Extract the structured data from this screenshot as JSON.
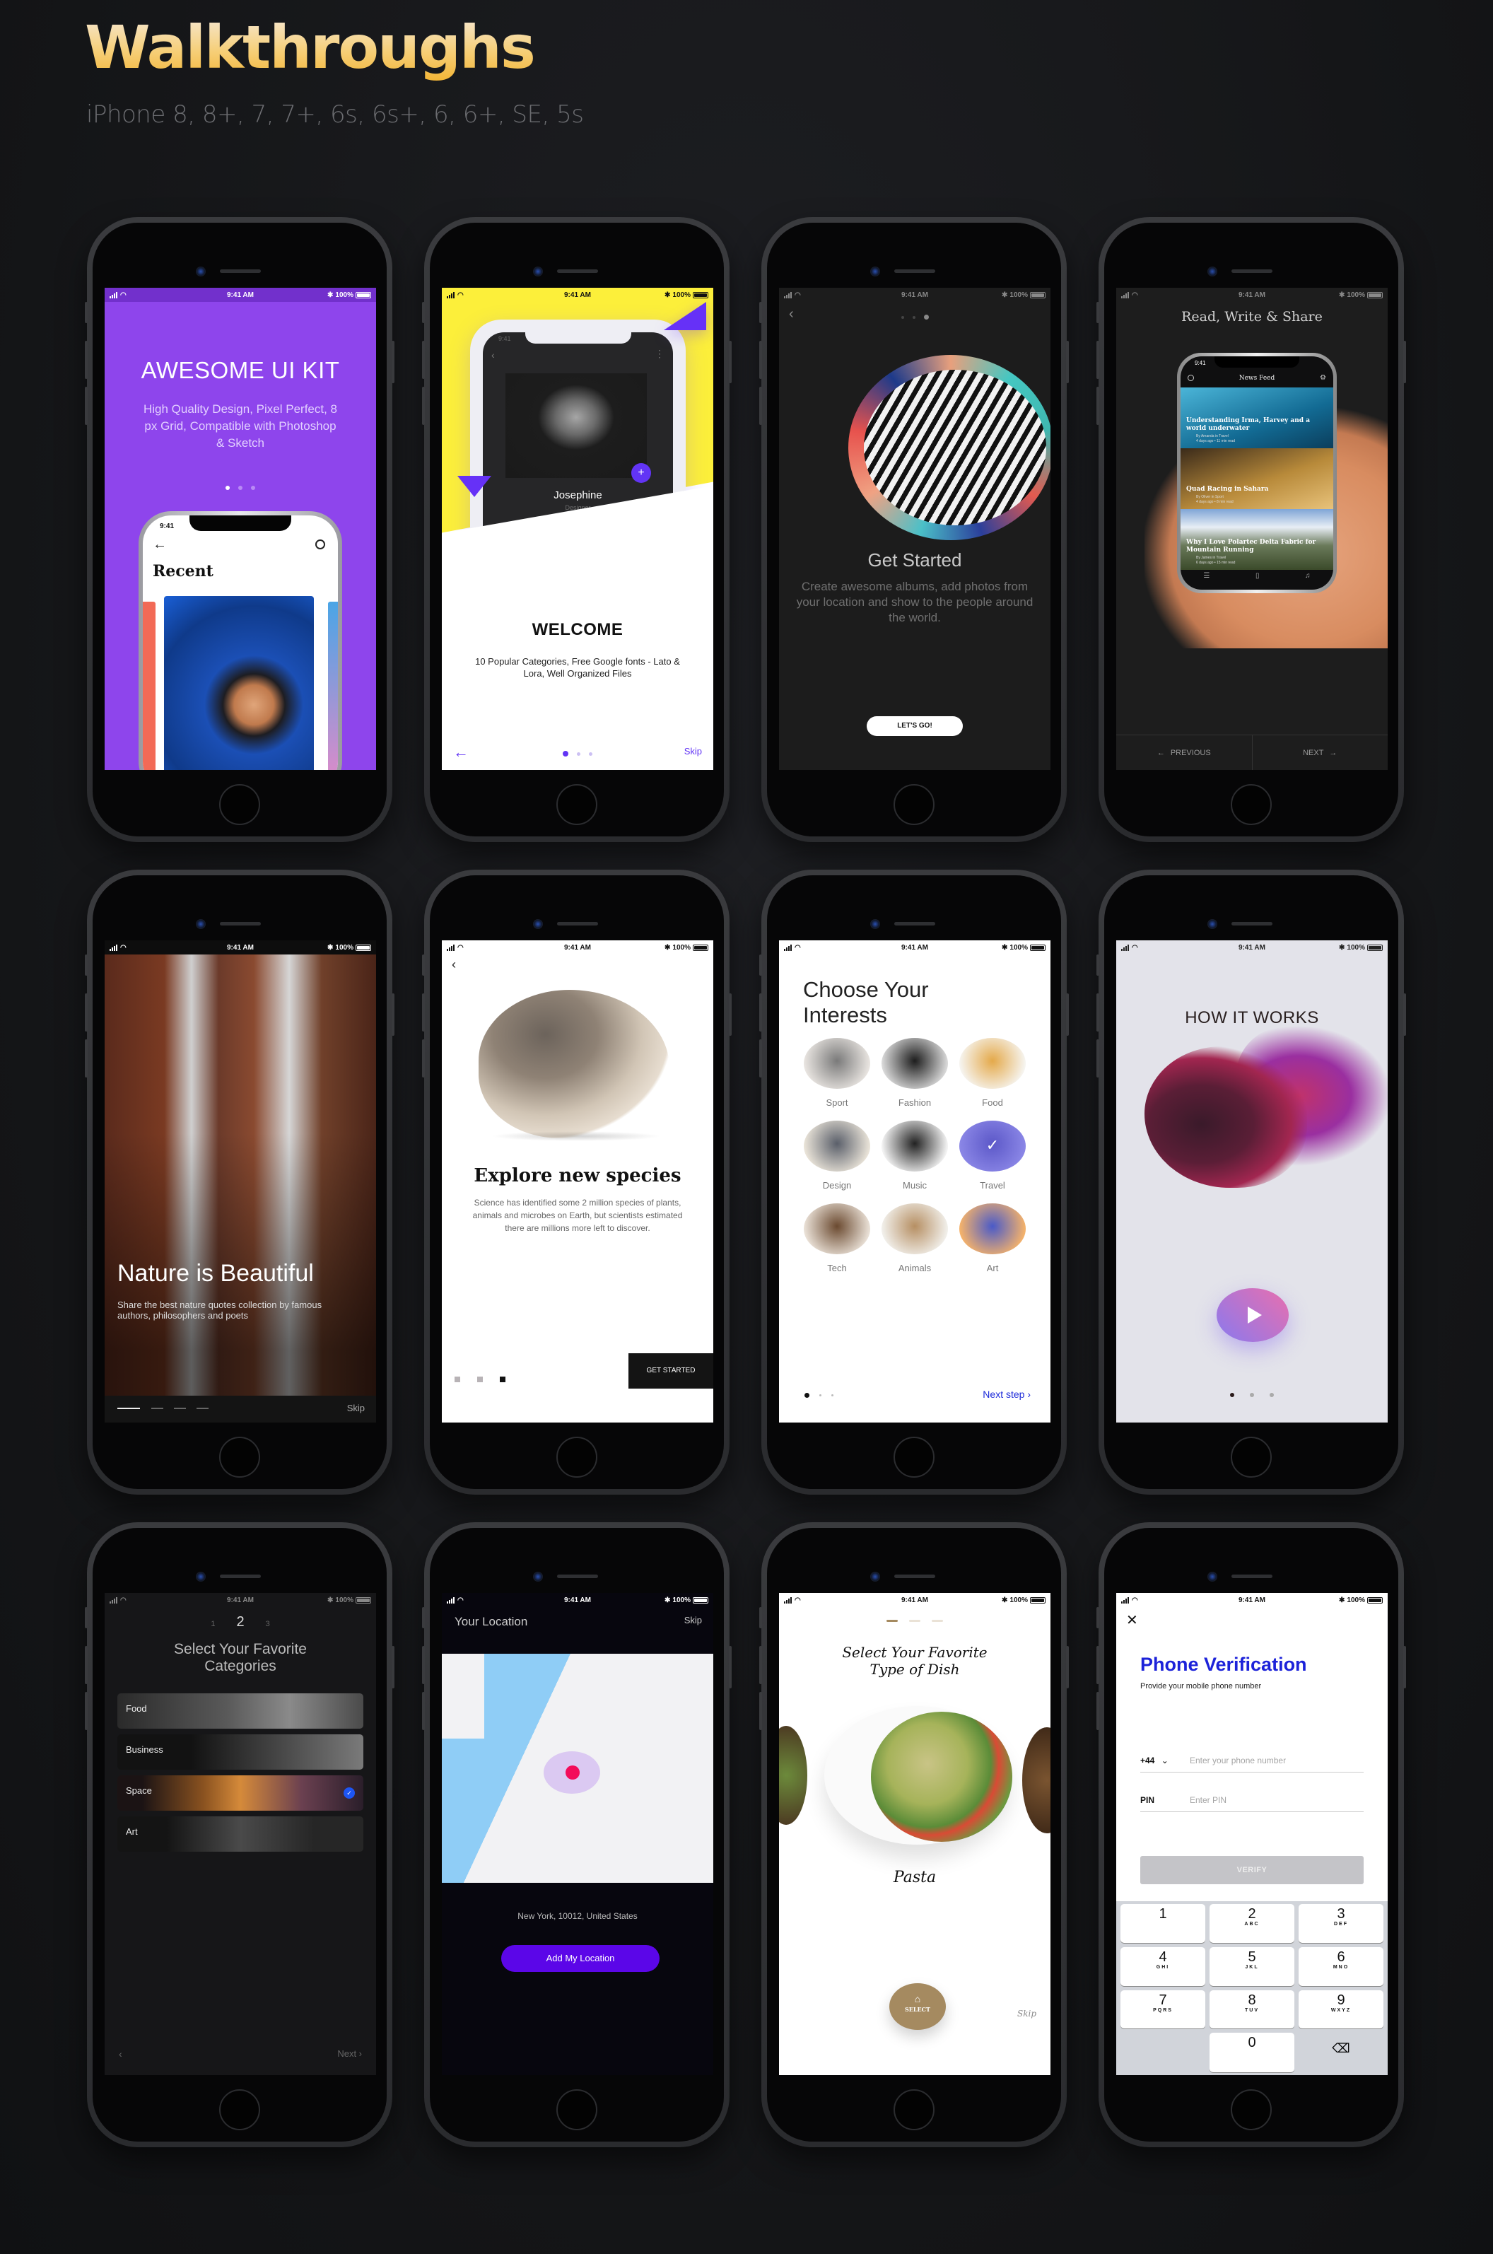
{
  "page": {
    "title": "Walkthroughs",
    "subtitle": "iPhone 8, 8+, 7, 7+, 6s, 6s+, 6, 6+, SE, 5s"
  },
  "status_bar": {
    "time": "9:41 AM",
    "battery": "100%",
    "bluetooth_glyph": "✱"
  },
  "screens": {
    "awesome_ui_kit": {
      "title": "AWESOME UI KIT",
      "description": "High Quality Design, Pixel Perfect, 8 px Grid, Compatible with Photoshop & Sketch",
      "page_dots": 3,
      "active_dot": 1,
      "accent": "#8e45ec",
      "inner_app": {
        "time": "9:41",
        "back_glyph": "←",
        "heading": "Recent"
      }
    },
    "welcome": {
      "title": "WELCOME",
      "description": "10 Popular Categories, Free Google fonts - Lato & Lora, Well Organized Files",
      "back_glyph": "←",
      "skip_label": "Skip",
      "page_dots": 3,
      "active_dot": 1,
      "accent": "#6234f5",
      "inner_app": {
        "time": "9:41",
        "back_glyph": "‹",
        "more_glyph": "⋮",
        "fab_glyph": "+",
        "name": "Josephine",
        "role": "Designer"
      }
    },
    "get_started": {
      "back_glyph": "‹",
      "title": "Get Started",
      "description": "Create awesome albums, add photos from your location and show to the people around the world.",
      "cta_label": "LET'S GO!",
      "page_dots": 3,
      "active_dot": 3
    },
    "read_write_share": {
      "title": "Read, Write & Share",
      "inner_app": {
        "time": "9:41",
        "title": "News Feed",
        "filter_glyph": "⚙",
        "articles": [
          {
            "title": "Understanding Irma, Harvey and a world underwater",
            "byline": "By Amanda in Travel",
            "meta": "4 days ago • 11 min read"
          },
          {
            "title": "Quad Racing in Sahara",
            "byline": "By Oliver in Sport",
            "meta": "4 days ago • 8 min read"
          },
          {
            "title": "Why I Love Polartec Delta Fabric for Mountain Running",
            "byline": "By James in Travel",
            "meta": "6 days ago • 15 min read"
          }
        ],
        "tabbar": [
          "☰",
          "▯",
          "♫"
        ]
      },
      "previous_label": "PREVIOUS",
      "next_label": "NEXT",
      "prev_glyph": "←",
      "next_glyph": "→"
    },
    "nature": {
      "title": "Nature is Beautiful",
      "description": "Share the best nature quotes collection by famous authors, philosophers and poets",
      "skip_label": "Skip",
      "page_dashes": 4,
      "active_dash": 1
    },
    "explore_species": {
      "back_glyph": "‹",
      "title": "Explore new species",
      "description": "Science has identified some 2 million species of plants, animals and microbes on Earth, but scientists estimated there are millions more left to discover.",
      "cta_label": "GET STARTED",
      "page_squares": 3,
      "active_square": 3
    },
    "interests": {
      "title_line1": "Choose Your",
      "title_line2": "Interests",
      "items": [
        {
          "label": "Sport",
          "selected": false,
          "color_a": "#e8e4e0",
          "color_b": "#7a7a7a"
        },
        {
          "label": "Fashion",
          "selected": false,
          "color_a": "#d8d8d8",
          "color_b": "#1d1d1d"
        },
        {
          "label": "Food",
          "selected": false,
          "color_a": "#f6f4ef",
          "color_b": "#e4a94a"
        },
        {
          "label": "Design",
          "selected": false,
          "color_a": "#e9e3d8",
          "color_b": "#5a5f6a"
        },
        {
          "label": "Music",
          "selected": false,
          "color_a": "#f2f2f2",
          "color_b": "#222222"
        },
        {
          "label": "Travel",
          "selected": true,
          "color_a": "#8a86e6",
          "color_b": "#5c58c8"
        },
        {
          "label": "Tech",
          "selected": false,
          "color_a": "#e9e0d6",
          "color_b": "#6b4a30"
        },
        {
          "label": "Animals",
          "selected": false,
          "color_a": "#f1efea",
          "color_b": "#b68f63"
        },
        {
          "label": "Art",
          "selected": false,
          "color_a": "#f4b26b",
          "color_b": "#4a5ac8"
        }
      ],
      "check_glyph": "✓",
      "next_label": "Next step",
      "next_glyph": "›",
      "page_dots": 3,
      "active_dot": 1
    },
    "how_it_works": {
      "title": "HOW IT WORKS",
      "page_dots": 3,
      "active_dot": 1
    },
    "categories": {
      "steps": [
        "1",
        "2",
        "3"
      ],
      "current_step": "2",
      "title_line1": "Select Your Favorite",
      "title_line2": "Categories",
      "items": [
        {
          "label": "Food",
          "selected": false
        },
        {
          "label": "Business",
          "selected": false
        },
        {
          "label": "Space",
          "selected": true
        },
        {
          "label": "Art",
          "selected": false
        }
      ],
      "check_glyph": "✓",
      "back_glyph": "‹",
      "next_label": "Next  ›"
    },
    "location": {
      "title": "Your Location",
      "skip_label": "Skip",
      "address": "New York, 10012, United States",
      "cta_label": "Add My Location"
    },
    "dish": {
      "title_line1": "Select Your Favorite",
      "title_line2": "Type of Dish",
      "dish_name": "Pasta",
      "select_label": "SELECT",
      "bell_glyph": "⌂",
      "skip_label": "Skip",
      "page_bars": 3,
      "active_bar": 1,
      "accent": "#a58a60"
    },
    "phone_verification": {
      "close_glyph": "✕",
      "title": "Phone Verification",
      "subtitle": "Provide your mobile phone number",
      "country_code": "+44",
      "chevron_glyph": "⌄",
      "phone_placeholder": "Enter your phone number",
      "pin_label": "PIN",
      "pin_placeholder": "Enter PIN",
      "verify_label": "VERIFY",
      "keypad": [
        {
          "digit": "1",
          "letters": ""
        },
        {
          "digit": "2",
          "letters": "ABC"
        },
        {
          "digit": "3",
          "letters": "DEF"
        },
        {
          "digit": "4",
          "letters": "GHI"
        },
        {
          "digit": "5",
          "letters": "JKL"
        },
        {
          "digit": "6",
          "letters": "MNO"
        },
        {
          "digit": "7",
          "letters": "PQRS"
        },
        {
          "digit": "8",
          "letters": "TUV"
        },
        {
          "digit": "9",
          "letters": "WXYZ"
        },
        {
          "digit": "",
          "letters": ""
        },
        {
          "digit": "0",
          "letters": ""
        },
        {
          "digit": "⌫",
          "letters": ""
        }
      ],
      "accent": "#1c22d9"
    }
  }
}
